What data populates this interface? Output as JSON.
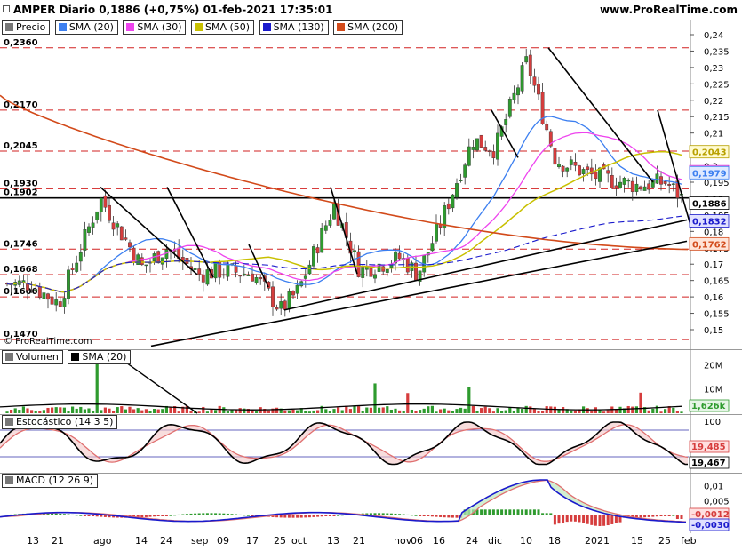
{
  "header": {
    "title": "AMPER Diario 0,1886 (+0,75%) 01-feb-2021 17:35:01",
    "site": "www.ProRealTime.com"
  },
  "copyright": "© ProRealTime.com",
  "colors": {
    "up": "#2e9b2e",
    "down": "#d63d3d",
    "sma20": "#3c7ff0",
    "sma30": "#ee44ee",
    "sma50": "#c8c000",
    "sma130": "#1a1acc",
    "sma200": "#d24a1a",
    "hline": "#d22020"
  },
  "price_panel": {
    "legend": [
      "Precio",
      "SMA (20)",
      "SMA (30)",
      "SMA (50)",
      "SMA (130)",
      "SMA (200)"
    ],
    "y_ticks": [
      "0,24",
      "0,235",
      "0,23",
      "0,225",
      "0,22",
      "0,215",
      "0,21",
      "0,205",
      "0,2",
      "0,195",
      "0,19",
      "0,185",
      "0,18",
      "0,175",
      "0,17",
      "0,165",
      "0,16",
      "0,155",
      "0,15"
    ],
    "level_labels": [
      "0,2360",
      "0,2170",
      "0,2045",
      "0,1930",
      "0,1902",
      "0,1746",
      "0,1668",
      "0,1600",
      "0,1470"
    ],
    "value_labels": [
      {
        "text": "0,2043",
        "bg": "#fffbd0",
        "fg": "#b8a000",
        "v": 0.2043
      },
      {
        "text": "0,1982",
        "bg": "#ffe0ff",
        "fg": "#d020d0",
        "v": 0.1982
      },
      {
        "text": "0,1979",
        "bg": "#dfeaff",
        "fg": "#3c7ff0",
        "v": 0.1979
      },
      {
        "text": "0,1886",
        "bg": "#ffffff",
        "fg": "#000000",
        "v": 0.1886
      },
      {
        "text": "0,1832",
        "bg": "#e0e0ff",
        "fg": "#1a1acc",
        "v": 0.1832
      },
      {
        "text": "0,1762",
        "bg": "#ffe4d8",
        "fg": "#d24a1a",
        "v": 0.1762
      }
    ]
  },
  "volume_panel": {
    "legend": [
      "Volumen",
      "SMA (20)"
    ],
    "y_ticks": [
      "20M",
      "10M"
    ],
    "value_labels": [
      {
        "text": "1,626k",
        "bg": "#e6f5e6",
        "fg": "#2e9b2e"
      }
    ]
  },
  "stoch_panel": {
    "legend": [
      "Estocástico (14 3 5)"
    ],
    "y_ticks": [
      "100",
      "50"
    ],
    "value_labels": [
      {
        "text": "19,485",
        "bg": "#ffe0e0",
        "fg": "#d63d3d"
      },
      {
        "text": "19,467",
        "bg": "#ffffff",
        "fg": "#000000"
      }
    ]
  },
  "macd_panel": {
    "legend": [
      "MACD (12 26 9)"
    ],
    "y_ticks": [
      "0,01",
      "0,005",
      "0"
    ],
    "value_labels": [
      {
        "text": "-0,0012",
        "bg": "#ffe0e0",
        "fg": "#d63d3d"
      },
      {
        "text": "-0,0030",
        "bg": "#e0e0ff",
        "fg": "#1a1acc"
      }
    ]
  },
  "x_labels": [
    "13",
    "21",
    "ago",
    "14",
    "24",
    "sep",
    "09",
    "17",
    "25",
    "oct",
    "13",
    "21",
    "nov",
    "06",
    "16",
    "24",
    "dic",
    "10",
    "18",
    "2021",
    "15",
    "25",
    "feb"
  ],
  "chart_data": {
    "type": "candlestick",
    "title": "AMPER Diario 0,1886 (+0,75%) 01-feb-2021 17:35:01",
    "ylim": [
      0.145,
      0.242
    ],
    "last_close": 0.1886,
    "change_pct": 0.75,
    "horizontal_levels": [
      0.236,
      0.217,
      0.2045,
      0.193,
      0.1902,
      0.1746,
      0.1668,
      0.16,
      0.147
    ],
    "close_path": [
      {
        "x": "13",
        "y": 0.163
      },
      {
        "x": "21",
        "y": 0.158
      },
      {
        "x": "ago",
        "y": 0.19
      },
      {
        "x": "14",
        "y": 0.169
      },
      {
        "x": "24",
        "y": 0.175
      },
      {
        "x": "sep",
        "y": 0.167
      },
      {
        "x": "09",
        "y": 0.168
      },
      {
        "x": "17",
        "y": 0.167
      },
      {
        "x": "25",
        "y": 0.156
      },
      {
        "x": "oct",
        "y": 0.162
      },
      {
        "x": "13",
        "y": 0.188
      },
      {
        "x": "21",
        "y": 0.168
      },
      {
        "x": "nov",
        "y": 0.172
      },
      {
        "x": "06",
        "y": 0.167
      },
      {
        "x": "16",
        "y": 0.182
      },
      {
        "x": "24",
        "y": 0.208
      },
      {
        "x": "dic",
        "y": 0.205
      },
      {
        "x": "10",
        "y": 0.232
      },
      {
        "x": "18",
        "y": 0.202
      },
      {
        "x": "2021",
        "y": 0.197
      },
      {
        "x": "15",
        "y": 0.194
      },
      {
        "x": "25",
        "y": 0.195
      },
      {
        "x": "feb",
        "y": 0.1886
      }
    ],
    "sma_last": {
      "SMA (20)": 0.1979,
      "SMA (30)": 0.1982,
      "SMA (50)": 0.2043,
      "SMA (130)": 0.1832,
      "SMA (200)": 0.1762
    },
    "stochastic_last": [
      19.485,
      19.467
    ],
    "macd_last": [
      -0.0012,
      -0.003
    ]
  }
}
